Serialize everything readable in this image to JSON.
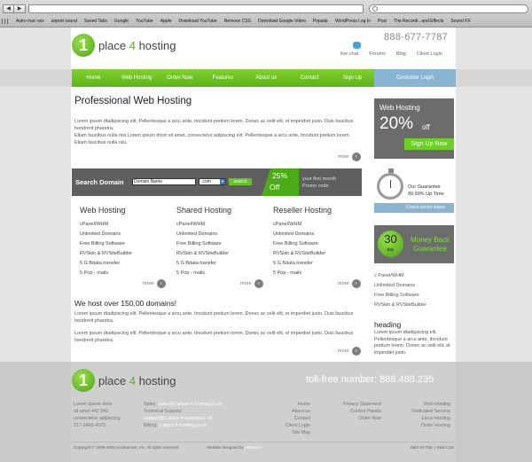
{
  "browser": {
    "back": "◀",
    "forward": "▶",
    "bookmarks": [
      "Astro mac osx",
      "airport sound",
      "Saved Tabs",
      "Google",
      "YouTube",
      "Apple",
      "Download YouTube",
      "Remove CSS",
      "Download Google Video",
      "Popular",
      "WordPress Log In",
      "Post",
      "The Recordi...and Effects",
      "Sound FX"
    ]
  },
  "header": {
    "logo_number": "1",
    "logo_word1": "place",
    "logo_four": "4",
    "logo_word2": "hosting",
    "phone": "888-677-7787",
    "links": [
      "live chat",
      "Forums",
      "Blog",
      "Client Login"
    ]
  },
  "menu": {
    "items": [
      "Home",
      "Web Hosting",
      "Order Now",
      "Features",
      "About us",
      "Contact",
      "Sign Up"
    ],
    "customer_login": "Customer Login"
  },
  "main": {
    "title": "Professional Web Hosting",
    "intro": "Lorem ipsum dtadipiscing elit. Pellentesque a arcu ante, tincidunt pretium lorem. Donec ac velit elit, et imperdiet justo. Duis faucibus hendrerit pharetra.",
    "intro2": "Etiam fauoibus nulla nisi.Lorem ipsum dolor sit amet, consectetur adipiscing elit. Pellentesque a arcu ante, tincidunt pretium lorem. Etiam faucibus nulla nisi.",
    "more": "more",
    "search": {
      "label": "Search Domain",
      "input_value": "Domain Name",
      "tld": ".com",
      "go": "search",
      "promo_pct": "25%",
      "promo_off": "Off",
      "promo_line1": "your first month",
      "promo_line2": "Promo code"
    },
    "columns": [
      {
        "title": "Web Hosting",
        "items": [
          "cPanel/WHM",
          "Unlimited Domains",
          "Free Billing Software",
          "RVSkin & RVSiteBuilder",
          "5 G Bdata transfer",
          "5 Pop - mails"
        ]
      },
      {
        "title": "Shared Hosting",
        "items": [
          "cPanel/WHM",
          "Unlimited Domains",
          "Free Billing Software",
          "RVSkin & RVSiteBuilder",
          "5 G Bdata transfer",
          "5 Pop - mails"
        ]
      },
      {
        "title": "Reseller Hosting",
        "items": [
          "cPanel/WHM",
          "Unlimited Domains",
          "Free Billing Software",
          "RVSkin & RVSiteBuilder",
          "5 G Bdata transfer",
          "5 Pop - mails"
        ]
      }
    ],
    "sub_title": "We host over 150,00 domains!",
    "sub_para1": "Lorem ipsum dtadipiscing elit. Pellentesque a arcu ante, tincidunt pretium lorem. Donec ac velit elit, et imperdiet justo. Duis faucibus hendrerit pharetra.",
    "sub_para2": "Lorem ipsum dtadipiscing elit. Pellentesque a arcu ante, tincidunt pretium lorem. Donec ac velit elit, et imperdiet justo. Duis faucibus hendrerit pharetra."
  },
  "sidebar": {
    "promo_title": "Web Hosting",
    "promo_pct": "20%",
    "promo_off": "off",
    "promo_btn": "Sign Up Now",
    "guarantee1": "Our Guarantee",
    "guarantee2": "99.99% Up Time",
    "status_link": "Check server status",
    "money_days": "30",
    "money_day_label": "day",
    "money_text": "Money Back Guarantee",
    "links": [
      "c Panel/WHM",
      "Unlimited Domains",
      "Free Billing Software",
      "RVSkin & RVSiteBuilder"
    ],
    "heading": "heading",
    "para": "Lorem ipsum dtadipiscing elit. Pellentesque a arcu ante, tincidunt pretium lorem. Donec ac velit elit, et imperdiet justo."
  },
  "footer": {
    "tollfree": "toll-free number: 888.488.235",
    "address": [
      "Lorem ipsum dolor",
      "sit amet 442 943",
      "consectetur adipiscing",
      "217-2466-4675"
    ],
    "sales_label": "Sales:",
    "sales_value": "sales@1 place 4 hosting.co.uk",
    "support_label": "Technical Support:",
    "support_value": "support@1 place 4 hosting.co.uk",
    "billing_label": "Billing:",
    "billing_value": "1 place 4 hosting.co.uk",
    "col1": [
      "Home",
      "About us",
      "Contact",
      "Client Login",
      "Site Map"
    ],
    "col2": [
      "Privacy Statement",
      "Control Panels",
      "Order Now"
    ],
    "col3": [
      "Web Hosting",
      "Dedicated Servers",
      "Linux Hosting",
      "Order Hosting"
    ],
    "copyright": "Copyright © 1999-2009 xxxbluehost, Inc. All rights reserved",
    "designed": "Website designed by",
    "designer": "Bdbraves",
    "valid": "Valid XHTML | Valid CSS"
  }
}
